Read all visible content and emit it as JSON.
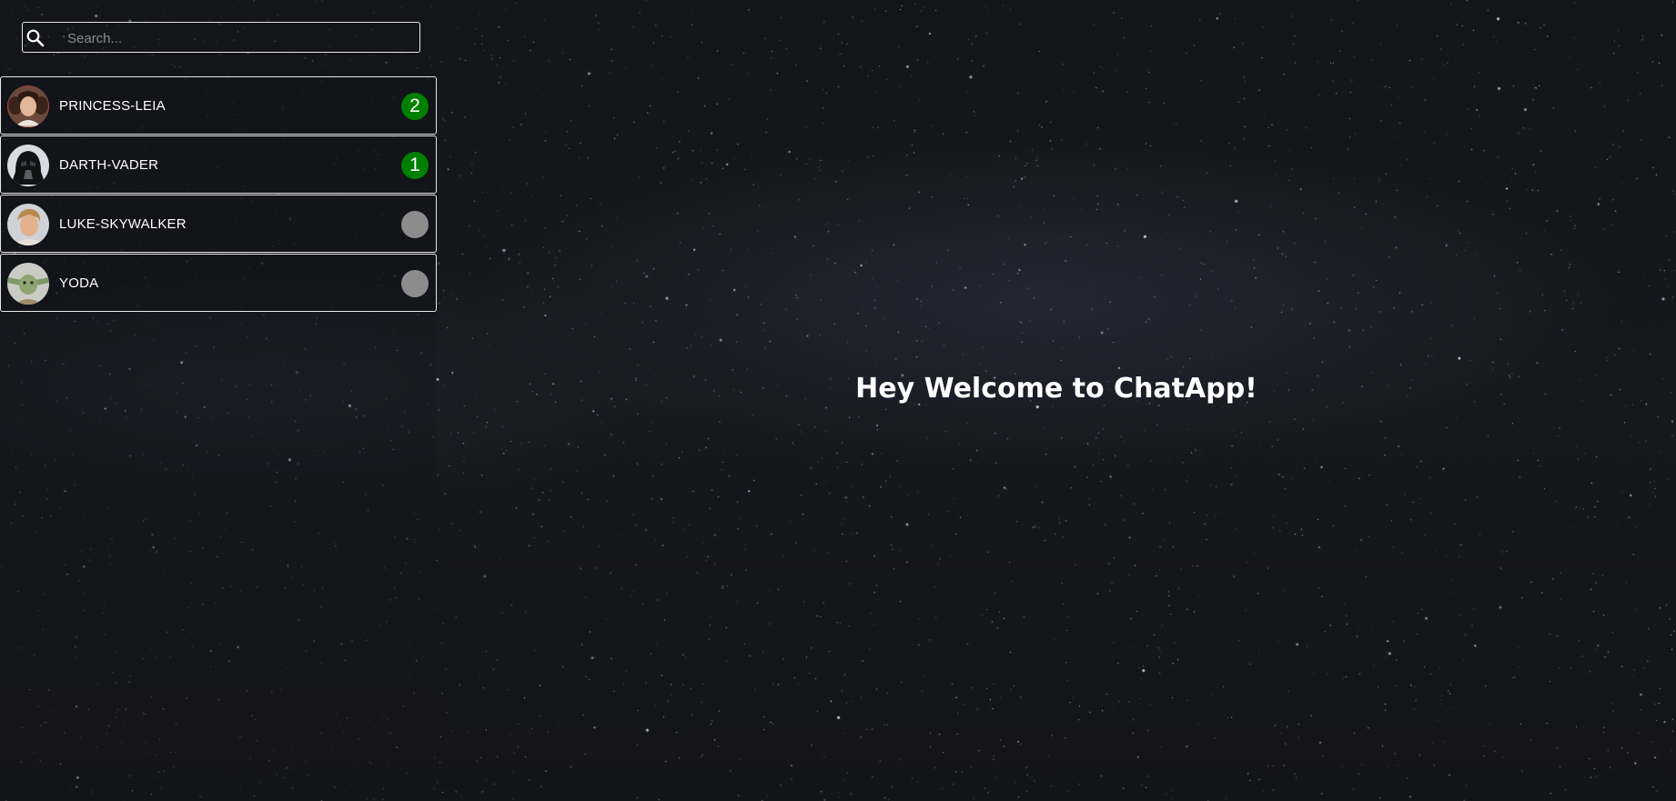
{
  "search": {
    "placeholder": "Search...",
    "value": "",
    "icon": "search-icon"
  },
  "contacts": [
    {
      "name": "PRINCESS-LEIA",
      "unread": "2",
      "badge_color": "#008000",
      "avatar": "princess-leia-avatar"
    },
    {
      "name": "DARTH-VADER",
      "unread": "1",
      "badge_color": "#008000",
      "avatar": "darth-vader-avatar"
    },
    {
      "name": "LUKE-SKYWALKER",
      "unread": "",
      "badge_color": "#8c8c8c",
      "avatar": "luke-skywalker-avatar"
    },
    {
      "name": "YODA",
      "unread": "",
      "badge_color": "#8c8c8c",
      "avatar": "yoda-avatar"
    }
  ],
  "main": {
    "welcome": "Hey Welcome to ChatApp!"
  },
  "colors": {
    "background": "#15161c",
    "text": "#ffffff",
    "border": "#e8e8e8",
    "unread_badge": "#008000",
    "empty_badge": "#8c8c8c"
  }
}
